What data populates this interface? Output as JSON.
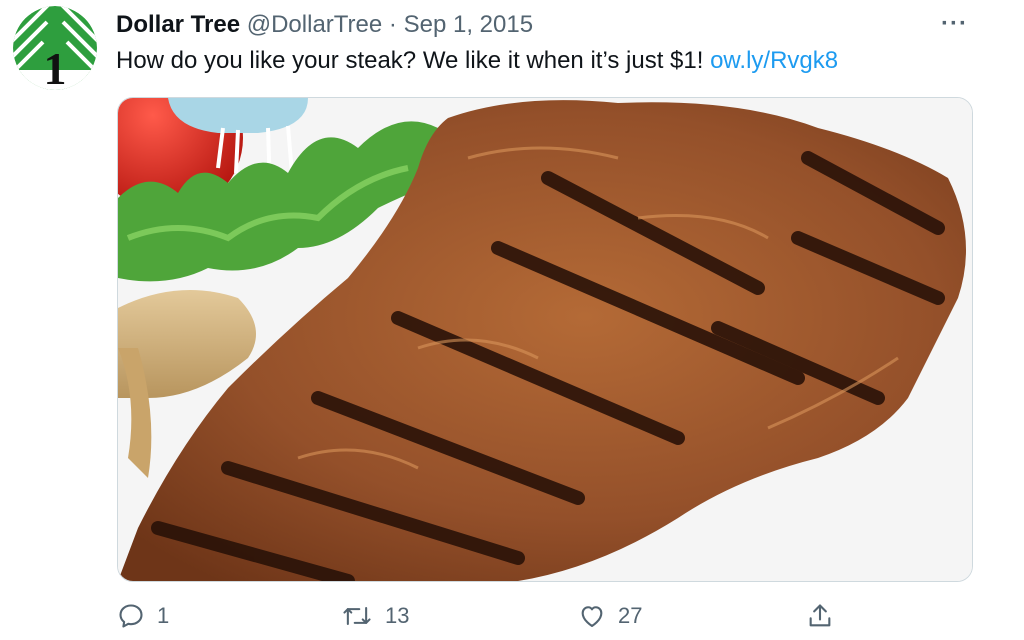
{
  "author": {
    "name": "Dollar Tree",
    "handle": "@DollarTree",
    "separator": "·",
    "date": "Sep 1, 2015",
    "avatar_logo_numeral": "1"
  },
  "menu": {
    "more_label": "···"
  },
  "tweet": {
    "text": "How do you like your steak? We like it when it’s just $1! ",
    "link": "ow.ly/Rvgk8",
    "media_description": "Grilled steak with lettuce, tomato and mushrooms"
  },
  "actions": {
    "reply": {
      "icon": "reply-icon",
      "count": "1"
    },
    "retweet": {
      "icon": "retweet-icon",
      "count": "13"
    },
    "like": {
      "icon": "heart-icon",
      "count": "27"
    },
    "share": {
      "icon": "share-icon"
    }
  },
  "colors": {
    "brand_green": "#2e9e3e",
    "link_blue": "#1d9bf0",
    "secondary_text": "#536471",
    "steak_brown": "#8a4a22"
  }
}
